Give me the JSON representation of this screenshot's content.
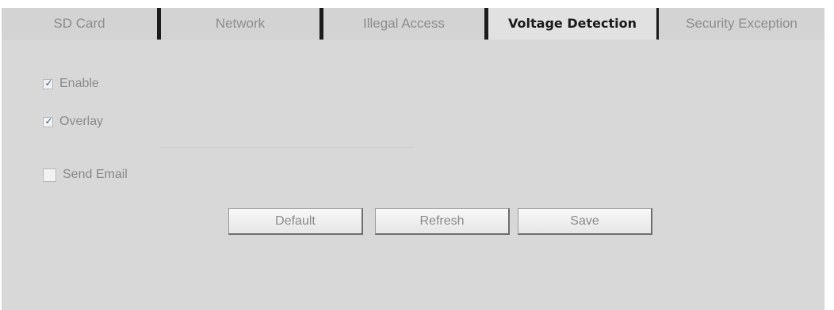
{
  "tabs": [
    {
      "label": "SD Card",
      "active": false
    },
    {
      "label": "Network",
      "active": false
    },
    {
      "label": "Illegal Access",
      "active": false
    },
    {
      "label": "Voltage Detection",
      "active": true
    },
    {
      "label": "Security Exception",
      "active": false
    }
  ],
  "options": {
    "enable": {
      "label": "Enable",
      "checked": true
    },
    "overlay": {
      "label": "Overlay",
      "checked": true
    },
    "send_email": {
      "label": "Send Email",
      "checked": false
    }
  },
  "buttons": {
    "default_label": "Default",
    "refresh_label": "Refresh",
    "save_label": "Save"
  },
  "colors": {
    "panel_bg": "#d8d8d8",
    "tab_bg": "#d3d3d3",
    "active_tab_bg": "#e1e1e1",
    "separator": "#1b1b1b",
    "checkmark": "#3a5f8a"
  }
}
